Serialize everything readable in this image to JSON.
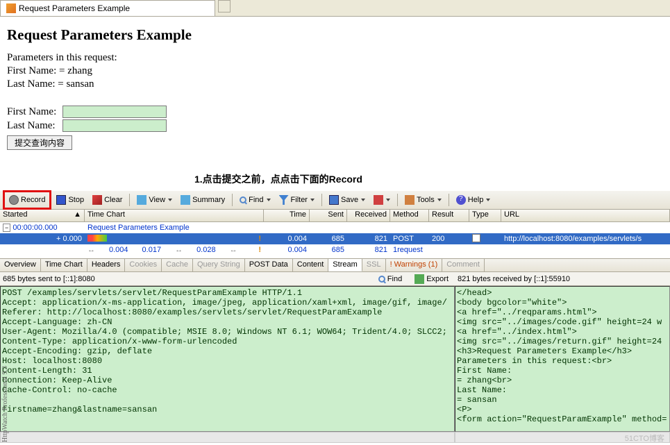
{
  "tab": {
    "title": "Request Parameters Example"
  },
  "page": {
    "heading": "Request Parameters Example",
    "intro": "Parameters in this request:",
    "first_name_disp": "First Name: = zhang",
    "last_name_disp": "Last Name: = sansan",
    "label_first": "First Name:",
    "label_last": "Last Name:",
    "submit": "提交查询内容"
  },
  "annotation": "1.点击提交之前，点点击下面的Record",
  "toolbar": {
    "record": "Record",
    "stop": "Stop",
    "clear": "Clear",
    "view": "View",
    "summary": "Summary",
    "find": "Find",
    "filter": "Filter",
    "save": "Save",
    "tools": "Tools",
    "help": "Help"
  },
  "cols": {
    "started": "Started",
    "time_chart": "Time Chart",
    "time": "Time",
    "sent": "Sent",
    "received": "Received",
    "method": "Method",
    "result": "Result",
    "type": "Type",
    "url": "URL"
  },
  "rows": {
    "group_time": "00:00:00.000",
    "group_title": "Request Parameters Example",
    "r1": {
      "started": "+ 0.000",
      "time": "0.004",
      "sent": "685",
      "recv": "821",
      "method": "POST",
      "result": "200",
      "url": "http://localhost:8080/examples/servlets/s"
    },
    "r2": {
      "t1": "0.004",
      "t2": "0.017",
      "t3": "0.028",
      "time": "0.004",
      "sent": "685",
      "recv": "821",
      "method": "1request"
    }
  },
  "dtabs": {
    "overview": "Overview",
    "time_chart": "Time Chart",
    "headers": "Headers",
    "cookies": "Cookies",
    "cache": "Cache",
    "query": "Query String",
    "post": "POST Data",
    "content": "Content",
    "stream": "Stream",
    "ssl": "SSL",
    "warnings": "! Warnings (1)",
    "comment": "Comment"
  },
  "info": {
    "sent": "685 bytes sent to [::1]:8080",
    "find": "Find",
    "export": "Export",
    "recv": "821 bytes received by [::1]:55910"
  },
  "stream_left": "POST /examples/servlets/servlet/RequestParamExample HTTP/1.1\nAccept: application/x-ms-application, image/jpeg, application/xaml+xml, image/gif, image/\nReferer: http://localhost:8080/examples/servlets/servlet/RequestParamExample\nAccept-Language: zh-CN\nUser-Agent: Mozilla/4.0 (compatible; MSIE 8.0; Windows NT 6.1; WOW64; Trident/4.0; SLCC2;\nContent-Type: application/x-www-form-urlencoded\nAccept-Encoding: gzip, deflate\nHost: localhost:8080\nContent-Length: 31\nConnection: Keep-Alive\nCache-Control: no-cache\n\nfirstname=zhang&lastname=sansan",
  "stream_right": "</head>\n<body bgcolor=\"white\">\n<a href=\"../reqparams.html\">\n<img src=\"../images/code.gif\" height=24 w\n<a href=\"../index.html\">\n<img src=\"../images/return.gif\" height=24\n<h3>Request Parameters Example</h3>\nParameters in this request:<br>\nFirst Name:\n= zhang<br>\nLast Name:\n= sansan\n<P>\n<form action=\"RequestParamExample\" method=",
  "vert": "HttpWatch Professional 9.3",
  "watermark": "51CTO博客"
}
